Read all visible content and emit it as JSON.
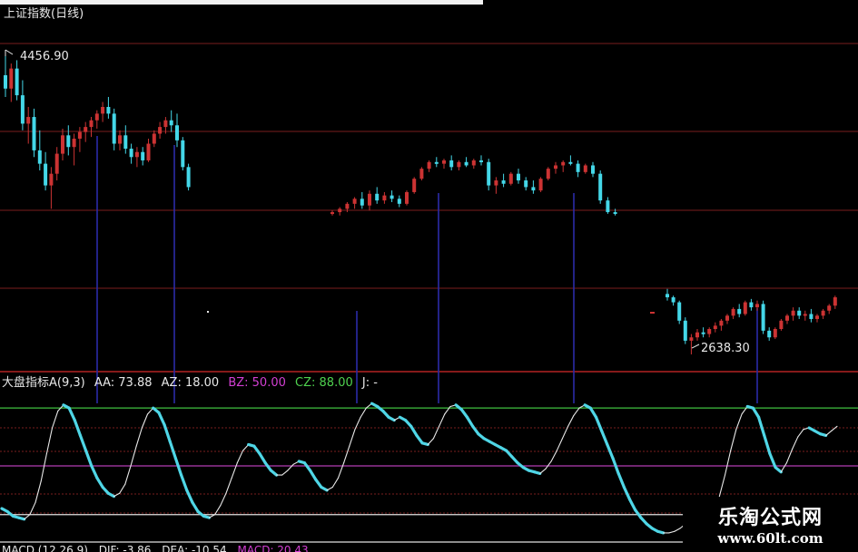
{
  "chart_data": [
    {
      "type": "candlestick",
      "title": "上证指数(日线)",
      "max_label": "4456.90",
      "min_label": "2638.30",
      "colors": {
        "up": "#cc3333",
        "down": "#44d7e8",
        "vline": "#2a2aa8",
        "grid": "#7a1e1e",
        "border": "#b22222"
      },
      "grid": true,
      "candles": [
        {
          "o": 4310,
          "h": 4457,
          "l": 4180,
          "c": 4230
        },
        {
          "o": 4230,
          "h": 4380,
          "l": 4150,
          "c": 4350
        },
        {
          "o": 4350,
          "h": 4400,
          "l": 4160,
          "c": 4190
        },
        {
          "o": 4190,
          "h": 4280,
          "l": 3980,
          "c": 4020
        },
        {
          "o": 4020,
          "h": 4120,
          "l": 3900,
          "c": 4060
        },
        {
          "o": 4060,
          "h": 4110,
          "l": 3820,
          "c": 3860
        },
        {
          "o": 3860,
          "h": 3980,
          "l": 3740,
          "c": 3780
        },
        {
          "o": 3780,
          "h": 3850,
          "l": 3620,
          "c": 3650
        },
        {
          "o": 3650,
          "h": 3760,
          "l": 3510,
          "c": 3720
        },
        {
          "o": 3720,
          "h": 3880,
          "l": 3680,
          "c": 3840
        },
        {
          "o": 3840,
          "h": 3990,
          "l": 3800,
          "c": 3950
        },
        {
          "o": 3950,
          "h": 4010,
          "l": 3830,
          "c": 3880
        },
        {
          "o": 3880,
          "h": 3960,
          "l": 3770,
          "c": 3930
        },
        {
          "o": 3930,
          "h": 4000,
          "l": 3850,
          "c": 3970
        },
        {
          "o": 3970,
          "h": 4030,
          "l": 3910,
          "c": 4000
        },
        {
          "o": 4000,
          "h": 4060,
          "l": 3940,
          "c": 4040
        },
        {
          "o": 4040,
          "h": 4100,
          "l": 3990,
          "c": 4080
        },
        {
          "o": 4080,
          "h": 4150,
          "l": 4030,
          "c": 4120
        },
        {
          "o": 4120,
          "h": 4180,
          "l": 4050,
          "c": 4080
        },
        {
          "o": 4080,
          "h": 4110,
          "l": 3860,
          "c": 3900
        },
        {
          "o": 3900,
          "h": 3980,
          "l": 3860,
          "c": 3950
        },
        {
          "o": 3950,
          "h": 4010,
          "l": 3840,
          "c": 3870
        },
        {
          "o": 3870,
          "h": 3900,
          "l": 3780,
          "c": 3820
        },
        {
          "o": 3820,
          "h": 3880,
          "l": 3760,
          "c": 3850
        },
        {
          "o": 3850,
          "h": 3880,
          "l": 3770,
          "c": 3800
        },
        {
          "o": 3800,
          "h": 3930,
          "l": 3790,
          "c": 3900
        },
        {
          "o": 3900,
          "h": 3980,
          "l": 3880,
          "c": 3960
        },
        {
          "o": 3960,
          "h": 4030,
          "l": 3930,
          "c": 4000
        },
        {
          "o": 4000,
          "h": 4060,
          "l": 3960,
          "c": 4040
        },
        {
          "o": 4040,
          "h": 4100,
          "l": 3970,
          "c": 4010
        },
        {
          "o": 4010,
          "h": 4080,
          "l": 3880,
          "c": 3920
        },
        {
          "o": 3920,
          "h": 3940,
          "l": 3740,
          "c": 3760
        },
        {
          "o": 3760,
          "h": 3780,
          "l": 3620,
          "c": 3640
        }
      ],
      "candles_mid": [
        {
          "o": 3480,
          "h": 3500,
          "l": 3470,
          "c": 3490
        },
        {
          "o": 3490,
          "h": 3520,
          "l": 3470,
          "c": 3510
        },
        {
          "o": 3510,
          "h": 3550,
          "l": 3490,
          "c": 3540
        },
        {
          "o": 3540,
          "h": 3580,
          "l": 3510,
          "c": 3570
        },
        {
          "o": 3570,
          "h": 3610,
          "l": 3510,
          "c": 3530
        },
        {
          "o": 3530,
          "h": 3620,
          "l": 3500,
          "c": 3600
        },
        {
          "o": 3600,
          "h": 3640,
          "l": 3540,
          "c": 3560
        },
        {
          "o": 3560,
          "h": 3610,
          "l": 3540,
          "c": 3590
        },
        {
          "o": 3590,
          "h": 3620,
          "l": 3550,
          "c": 3570
        },
        {
          "o": 3570,
          "h": 3590,
          "l": 3520,
          "c": 3540
        },
        {
          "o": 3540,
          "h": 3620,
          "l": 3530,
          "c": 3610
        },
        {
          "o": 3610,
          "h": 3700,
          "l": 3600,
          "c": 3690
        },
        {
          "o": 3690,
          "h": 3760,
          "l": 3680,
          "c": 3750
        },
        {
          "o": 3750,
          "h": 3800,
          "l": 3730,
          "c": 3790
        },
        {
          "o": 3790,
          "h": 3820,
          "l": 3760,
          "c": 3780
        },
        {
          "o": 3780,
          "h": 3810,
          "l": 3750,
          "c": 3800
        },
        {
          "o": 3800,
          "h": 3830,
          "l": 3740,
          "c": 3760
        },
        {
          "o": 3760,
          "h": 3800,
          "l": 3740,
          "c": 3790
        },
        {
          "o": 3790,
          "h": 3820,
          "l": 3760,
          "c": 3770
        },
        {
          "o": 3770,
          "h": 3810,
          "l": 3750,
          "c": 3800
        },
        {
          "o": 3800,
          "h": 3830,
          "l": 3770,
          "c": 3790
        },
        {
          "o": 3790,
          "h": 3810,
          "l": 3620,
          "c": 3650
        },
        {
          "o": 3650,
          "h": 3700,
          "l": 3600,
          "c": 3680
        },
        {
          "o": 3680,
          "h": 3720,
          "l": 3640,
          "c": 3660
        },
        {
          "o": 3660,
          "h": 3730,
          "l": 3650,
          "c": 3720
        },
        {
          "o": 3720,
          "h": 3750,
          "l": 3660,
          "c": 3680
        },
        {
          "o": 3680,
          "h": 3700,
          "l": 3620,
          "c": 3640
        },
        {
          "o": 3640,
          "h": 3680,
          "l": 3600,
          "c": 3620
        },
        {
          "o": 3620,
          "h": 3700,
          "l": 3610,
          "c": 3690
        },
        {
          "o": 3690,
          "h": 3760,
          "l": 3680,
          "c": 3750
        },
        {
          "o": 3750,
          "h": 3790,
          "l": 3720,
          "c": 3770
        },
        {
          "o": 3770,
          "h": 3800,
          "l": 3730,
          "c": 3790
        },
        {
          "o": 3790,
          "h": 3830,
          "l": 3770,
          "c": 3780
        },
        {
          "o": 3780,
          "h": 3800,
          "l": 3700,
          "c": 3730
        },
        {
          "o": 3730,
          "h": 3780,
          "l": 3720,
          "c": 3770
        },
        {
          "o": 3770,
          "h": 3790,
          "l": 3700,
          "c": 3720
        },
        {
          "o": 3720,
          "h": 3740,
          "l": 3540,
          "c": 3560
        },
        {
          "o": 3560,
          "h": 3580,
          "l": 3480,
          "c": 3490
        },
        {
          "o": 3490,
          "h": 3510,
          "l": 3470,
          "c": 3480
        }
      ],
      "candles_low": [
        {
          "o": 3000,
          "h": 3030,
          "l": 2960,
          "c": 2980
        },
        {
          "o": 2980,
          "h": 2990,
          "l": 2930,
          "c": 2950
        },
        {
          "o": 2950,
          "h": 2960,
          "l": 2820,
          "c": 2840
        },
        {
          "o": 2840,
          "h": 2860,
          "l": 2700,
          "c": 2720
        },
        {
          "o": 2720,
          "h": 2760,
          "l": 2638,
          "c": 2740
        },
        {
          "o": 2740,
          "h": 2790,
          "l": 2720,
          "c": 2770
        },
        {
          "o": 2770,
          "h": 2800,
          "l": 2740,
          "c": 2760
        },
        {
          "o": 2760,
          "h": 2800,
          "l": 2740,
          "c": 2790
        },
        {
          "o": 2790,
          "h": 2830,
          "l": 2770,
          "c": 2810
        },
        {
          "o": 2810,
          "h": 2850,
          "l": 2780,
          "c": 2840
        },
        {
          "o": 2840,
          "h": 2880,
          "l": 2820,
          "c": 2870
        },
        {
          "o": 2870,
          "h": 2920,
          "l": 2850,
          "c": 2910
        },
        {
          "o": 2910,
          "h": 2940,
          "l": 2860,
          "c": 2880
        },
        {
          "o": 2880,
          "h": 2960,
          "l": 2870,
          "c": 2950
        },
        {
          "o": 2950,
          "h": 2970,
          "l": 2900,
          "c": 2920
        },
        {
          "o": 2920,
          "h": 2960,
          "l": 2900,
          "c": 2940
        },
        {
          "o": 2940,
          "h": 2960,
          "l": 2760,
          "c": 2780
        },
        {
          "o": 2780,
          "h": 2800,
          "l": 2720,
          "c": 2740
        },
        {
          "o": 2740,
          "h": 2800,
          "l": 2730,
          "c": 2790
        },
        {
          "o": 2790,
          "h": 2850,
          "l": 2780,
          "c": 2840
        },
        {
          "o": 2840,
          "h": 2880,
          "l": 2820,
          "c": 2870
        },
        {
          "o": 2870,
          "h": 2920,
          "l": 2840,
          "c": 2900
        },
        {
          "o": 2900,
          "h": 2920,
          "l": 2850,
          "c": 2870
        },
        {
          "o": 2870,
          "h": 2900,
          "l": 2840,
          "c": 2880
        },
        {
          "o": 2880,
          "h": 2910,
          "l": 2830,
          "c": 2850
        },
        {
          "o": 2850,
          "h": 2880,
          "l": 2830,
          "c": 2870
        },
        {
          "o": 2870,
          "h": 2910,
          "l": 2850,
          "c": 2900
        },
        {
          "o": 2900,
          "h": 2940,
          "l": 2880,
          "c": 2930
        },
        {
          "o": 2930,
          "h": 2990,
          "l": 2910,
          "c": 2980
        }
      ],
      "ylim": [
        2600,
        4500
      ]
    },
    {
      "type": "line",
      "title": "大盘指标A(9,3)",
      "legend": [
        {
          "label": "AA: 73.88",
          "color": "#e8e8e8"
        },
        {
          "label": "AZ: 18.00",
          "color": "#e8e8e8"
        },
        {
          "label": "BZ: 50.00",
          "color": "#d33fd3"
        },
        {
          "label": "CZ: 88.00",
          "color": "#4fd24f"
        },
        {
          "label": "J: -",
          "color": "#e8e8e8"
        }
      ],
      "ylim": [
        0,
        100
      ],
      "levels": [
        {
          "name": "CZ",
          "value": 88,
          "color": "#3fbf3f"
        },
        {
          "name": "BZ",
          "value": 50,
          "color": "#b43cb4"
        },
        {
          "name": "AZ",
          "value": 18,
          "color": "#e0e0e0"
        }
      ],
      "series": [
        {
          "color": "#e8e8e8",
          "rising_color": "#e8e8e8",
          "falling_color": "#4fd6e6",
          "values": [
            22,
            20,
            17,
            16,
            15,
            18,
            26,
            40,
            58,
            75,
            86,
            90,
            88,
            80,
            70,
            60,
            50,
            42,
            36,
            32,
            30,
            32,
            38,
            50,
            63,
            75,
            84,
            88,
            85,
            77,
            66,
            55,
            44,
            34,
            26,
            20,
            17,
            16,
            18,
            24,
            32,
            42,
            52,
            60,
            64,
            63,
            58,
            52,
            47,
            44,
            44,
            47,
            51,
            53,
            52,
            47,
            41,
            36,
            34,
            36,
            42,
            52,
            63,
            74,
            82,
            88,
            91,
            89,
            86,
            82,
            80,
            82,
            80,
            76,
            70,
            65,
            64,
            68,
            76,
            84,
            89,
            90,
            87,
            82,
            76,
            71,
            68,
            66,
            64,
            62,
            60,
            56,
            52,
            49,
            47,
            46,
            45,
            48,
            53,
            60,
            68,
            76,
            83,
            88,
            90,
            88,
            82,
            73,
            64,
            55,
            45,
            36,
            28,
            21,
            16,
            12,
            9,
            7,
            6,
            6,
            7,
            9,
            12,
            15,
            18,
            22,
            null,
            null,
            30,
            44,
            60,
            74,
            84,
            89,
            88,
            82,
            70,
            58,
            49,
            46,
            52,
            61,
            69,
            74,
            75,
            73,
            71,
            70,
            73,
            76
          ]
        }
      ]
    }
  ],
  "macd_legend": [
    {
      "label": "MACD (12,26,9)",
      "color": "#e8e8e8"
    },
    {
      "label": "DIF: -3.86",
      "color": "#e8e8e8"
    },
    {
      "label": "DEA: -10.54",
      "color": "#e8e8e8"
    },
    {
      "label": "MACD: 20.43",
      "color": "#d33fd3"
    }
  ],
  "watermark": {
    "cn": "乐淘公式网",
    "url": "www.60lt.com"
  },
  "signals": [
    {
      "series": "price",
      "markers": 6
    }
  ]
}
